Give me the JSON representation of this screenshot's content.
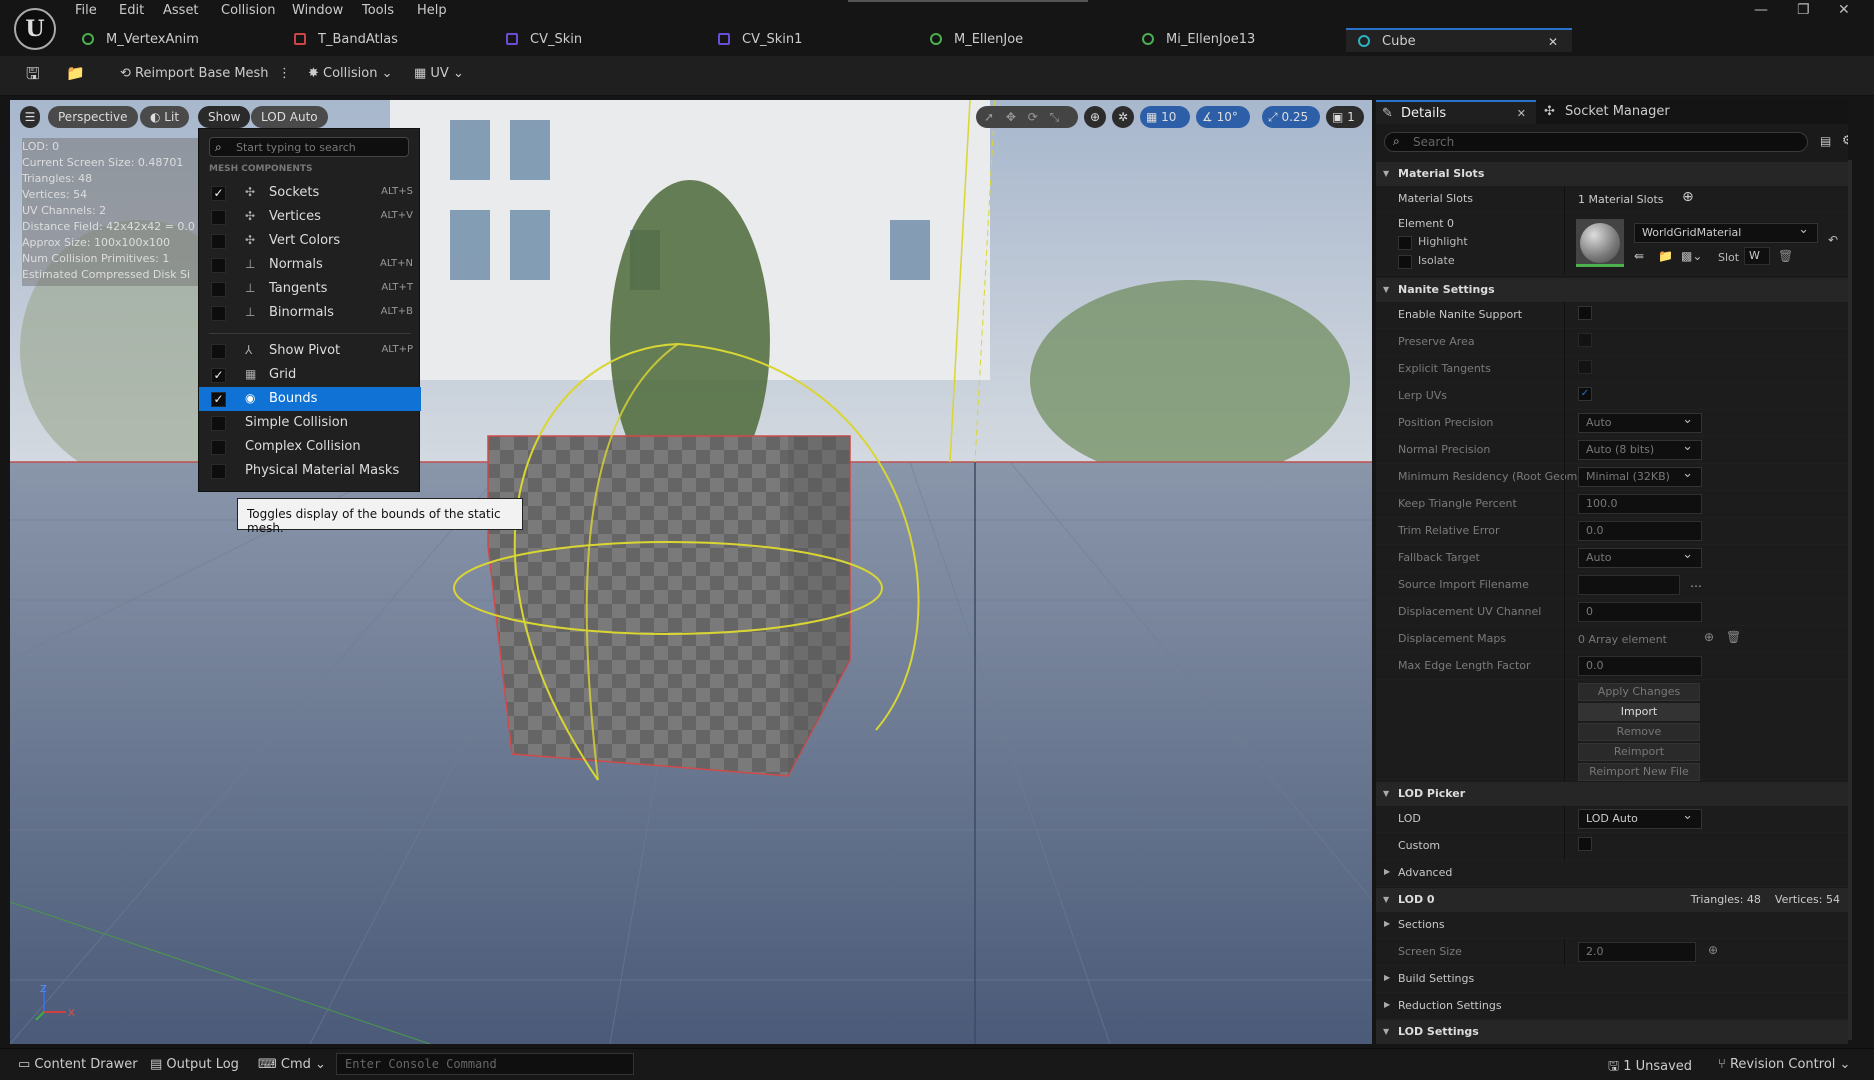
{
  "menubar": {
    "items": [
      "File",
      "Edit",
      "Asset",
      "Collision",
      "Window",
      "Tools",
      "Help"
    ]
  },
  "tabs": [
    {
      "label": "M_VertexAnim",
      "icon": "material-icon"
    },
    {
      "label": "T_BandAtlas",
      "icon": "texture-icon"
    },
    {
      "label": "CV_Skin",
      "icon": "curve-icon"
    },
    {
      "label": "CV_Skin1",
      "icon": "curve-icon"
    },
    {
      "label": "M_EllenJoe",
      "icon": "material-icon"
    },
    {
      "label": "Mi_EllenJoe13",
      "icon": "material-instance-icon"
    },
    {
      "label": "Cube",
      "icon": "static-mesh-icon"
    }
  ],
  "toolbar": {
    "reimport": "Reimport Base Mesh",
    "collision": "Collision",
    "uv": "UV"
  },
  "viewport": {
    "perspective": "Perspective",
    "lit": "Lit",
    "show": "Show",
    "lod": "LOD Auto",
    "grid_snap": "10",
    "rot_snap": "10°",
    "scale_snap": "0.25",
    "cam_speed": "1",
    "stats": [
      "LOD:  0",
      "Current Screen Size:  0.48701",
      "Triangles:  48",
      "Vertices:  54",
      "UV Channels:  2",
      "Distance Field:  42x42x42 = 0.0",
      "Approx Size: 100x100x100",
      "Num Collision Primitives:  1",
      "Estimated Compressed Disk Si"
    ]
  },
  "show_menu": {
    "search_placeholder": "Start typing to search",
    "section": "MESH COMPONENTS",
    "items": [
      {
        "label": "Sockets",
        "shortcut": "ALT+S",
        "checked": true
      },
      {
        "label": "Vertices",
        "shortcut": "ALT+V",
        "checked": false
      },
      {
        "label": "Vert Colors",
        "shortcut": "",
        "checked": false
      },
      {
        "label": "Normals",
        "shortcut": "ALT+N",
        "checked": false
      },
      {
        "label": "Tangents",
        "shortcut": "ALT+T",
        "checked": false
      },
      {
        "label": "Binormals",
        "shortcut": "ALT+B",
        "checked": false
      },
      {
        "label": "Show Pivot",
        "shortcut": "ALT+P",
        "checked": false
      },
      {
        "label": "Grid",
        "shortcut": "",
        "checked": true
      },
      {
        "label": "Bounds",
        "shortcut": "",
        "checked": true
      },
      {
        "label": "Simple Collision",
        "shortcut": "",
        "checked": false
      },
      {
        "label": "Complex Collision",
        "shortcut": "",
        "checked": false
      },
      {
        "label": "Physical Material Masks",
        "shortcut": "",
        "checked": false
      }
    ],
    "tooltip": "Toggles display of the bounds of the static mesh."
  },
  "details": {
    "tab_details": "Details",
    "tab_socket": "Socket Manager",
    "search_placeholder": "Search",
    "material_slots_header": "Material Slots",
    "material_slots_label": "Material Slots",
    "material_slots_value": "1 Material Slots",
    "element": "Element 0",
    "highlight": "Highlight",
    "isolate": "Isolate",
    "material": "WorldGridMaterial",
    "slot_label": "Slot",
    "slot_value": "W",
    "nanite_header": "Nanite Settings",
    "nanite_rows": [
      {
        "label": "Enable Nanite Support",
        "type": "check"
      },
      {
        "label": "Preserve Area",
        "type": "check"
      },
      {
        "label": "Explicit Tangents",
        "type": "check"
      },
      {
        "label": "Lerp UVs",
        "type": "check"
      },
      {
        "label": "Position Precision",
        "type": "dropdown",
        "value": "Auto"
      },
      {
        "label": "Normal Precision",
        "type": "dropdown",
        "value": "Auto (8 bits)"
      },
      {
        "label": "Minimum Residency (Root Geom",
        "type": "dropdown",
        "value": "Minimal (32KB)"
      },
      {
        "label": "Keep Triangle Percent",
        "type": "input",
        "value": "100.0"
      },
      {
        "label": "Trim Relative Error",
        "type": "input",
        "value": "0.0"
      },
      {
        "label": "Fallback Target",
        "type": "dropdown",
        "value": "Auto"
      },
      {
        "label": "Source Import Filename",
        "type": "file",
        "value": ""
      },
      {
        "label": "Displacement UV Channel",
        "type": "input",
        "value": "0"
      },
      {
        "label": "Displacement Maps",
        "type": "array",
        "value": "0 Array element"
      },
      {
        "label": "Max Edge Length Factor",
        "type": "input",
        "value": "0.0"
      }
    ],
    "buttons": [
      "Apply Changes",
      "Import",
      "Remove",
      "Reimport",
      "Reimport New File"
    ],
    "lod_picker_header": "LOD Picker",
    "lod_label": "LOD",
    "lod_value": "LOD Auto",
    "custom_label": "Custom",
    "advanced": "Advanced",
    "lod0_header": "LOD 0",
    "lod0_stats": "Triangles: 48    Vertices: 54",
    "sections": "Sections",
    "screen_size_label": "Screen Size",
    "screen_size_value": "2.0",
    "build_settings": "Build Settings",
    "reduction_settings": "Reduction Settings",
    "lod_settings": "LOD Settings"
  },
  "bottombar": {
    "content_drawer": "Content Drawer",
    "output_log": "Output Log",
    "cmd": "Cmd",
    "console_placeholder": "Enter Console Command",
    "unsaved": "1 Unsaved",
    "revision": "Revision Control"
  }
}
